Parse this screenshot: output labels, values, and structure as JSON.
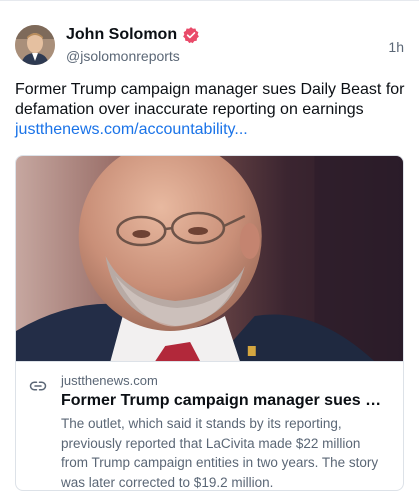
{
  "author": {
    "display_name": "John Solomon",
    "handle": "@jsolomonreports",
    "verified_badge_color": "#e94b6a"
  },
  "post": {
    "time": "1h",
    "text": "Former Trump campaign manager sues Daily Beast for defamation over inaccurate reporting on earnings",
    "link_text": "justthenews.com/accountability..."
  },
  "card": {
    "domain": "justthenews.com",
    "title": "Former Trump campaign manager sues Daily Beast for defamation over inaccurate reporting on earnings",
    "description": "The outlet, which said it stands by its reporting, previously reported that LaCivita made $22 million from Trump campaign entities in two years. The story was later corrected to $19.2 million.",
    "icon": "link-icon"
  },
  "colors": {
    "link": "#1a73e8",
    "muted": "#5b6776",
    "text": "#0b0f14"
  }
}
